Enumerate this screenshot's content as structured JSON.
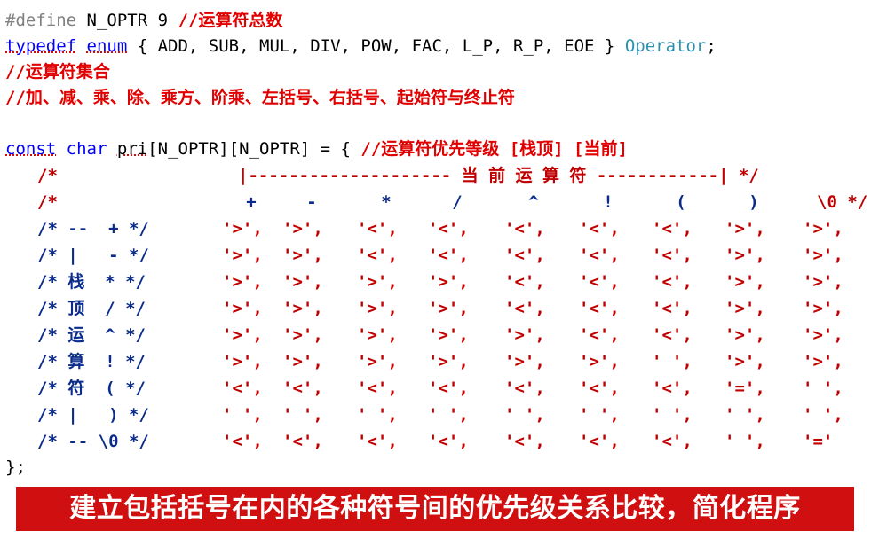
{
  "code": {
    "line1": {
      "pp": "#define",
      "name": " N_OPTR 9 ",
      "comment": "//运算符总数"
    },
    "line2": {
      "kw": "typedef",
      "sp1": " ",
      "kw2": "enum",
      "body": " { ADD, SUB, MUL, DIV, POW, FAC, L_P, R_P, EOE } ",
      "type": "Operator",
      "end": ";"
    },
    "line3": "//运算符集合",
    "line4": "//加、减、乘、除、乘方、阶乘、左括号、右括号、起始符与终止符",
    "line6": {
      "kw": "const",
      "sp": " ",
      "kw2": "char",
      "sp2": " ",
      "ident": "pri",
      "rest": "[N_OPTR][N_OPTR] = { ",
      "comment": "//运算符优先等级 [栈顶] [当前]"
    }
  },
  "matrix": {
    "header1": {
      "open": "/*",
      "bar": "|-------------------- 当 前 运 算 符 ------------| */"
    },
    "header2": {
      "open": "/*",
      "ops": [
        "+",
        "-",
        "*",
        "/",
        "^",
        "!",
        "(",
        ")"
      ],
      "tail": "\\0 */"
    },
    "rows": [
      {
        "label": "/* --  + */",
        "cells": [
          "'>',",
          "'>',",
          "'<',",
          "'<',",
          "'<',",
          "'<',",
          "'<',",
          "'>',",
          "'>',"
        ]
      },
      {
        "label": "/* |   - */",
        "cells": [
          "'>',",
          "'>',",
          "'<',",
          "'<',",
          "'<',",
          "'<',",
          "'<',",
          "'>',",
          "'>',"
        ]
      },
      {
        "label": "/* 栈  * */",
        "cells": [
          "'>',",
          "'>',",
          "'>',",
          "'>',",
          "'<',",
          "'<',",
          "'<',",
          "'>',",
          "'>',"
        ]
      },
      {
        "label": "/* 顶  / */",
        "cells": [
          "'>',",
          "'>',",
          "'>',",
          "'>',",
          "'<',",
          "'<',",
          "'<',",
          "'>',",
          "'>',"
        ]
      },
      {
        "label": "/* 运  ^ */",
        "cells": [
          "'>',",
          "'>',",
          "'>',",
          "'>',",
          "'>',",
          "'<',",
          "'<',",
          "'>',",
          "'>',"
        ]
      },
      {
        "label": "/* 算  ! */",
        "cells": [
          "'>',",
          "'>',",
          "'>',",
          "'>',",
          "'>',",
          "'>',",
          "' ',",
          "'>',",
          "'>',"
        ]
      },
      {
        "label": "/* 符  ( */",
        "cells": [
          "'<',",
          "'<',",
          "'<',",
          "'<',",
          "'<',",
          "'<',",
          "'<',",
          "'=',",
          "' ',"
        ]
      },
      {
        "label": "/* |   ) */",
        "cells": [
          "' ',",
          "' ',",
          "' ',",
          "' ',",
          "' ',",
          "' ',",
          "' ',",
          "' ',",
          "' ',"
        ]
      },
      {
        "label": "/* -- \\0 */",
        "cells": [
          "'<',",
          "'<',",
          "'<',",
          "'<',",
          "'<',",
          "'<',",
          "'<',",
          "' ',",
          "'='"
        ]
      }
    ],
    "closing": "};"
  },
  "banner": "建立包括括号在内的各种符号间的优先级关系比较，简化程序"
}
